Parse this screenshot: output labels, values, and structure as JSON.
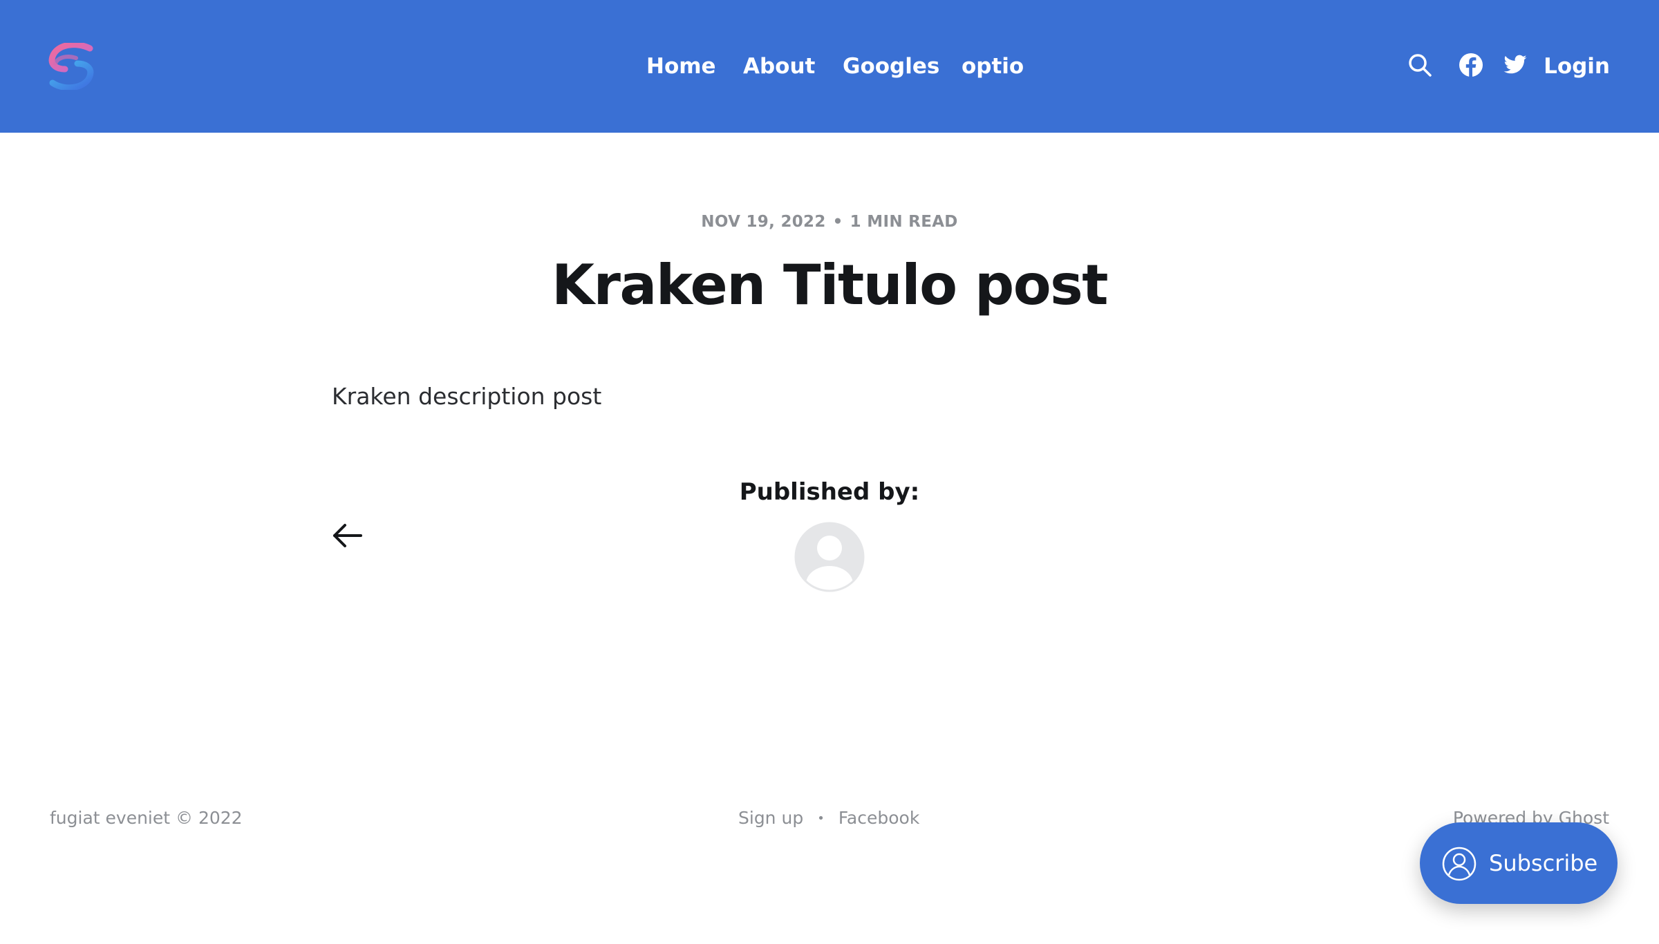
{
  "header": {
    "background_color": "#3a70d4",
    "logo_icon": "site-logo-icon",
    "nav": [
      {
        "label": "Home"
      },
      {
        "label": "About"
      },
      {
        "label": "Googles"
      },
      {
        "label": "optio"
      }
    ],
    "icons": [
      "search-icon",
      "facebook-icon",
      "twitter-icon"
    ],
    "login_label": "Login"
  },
  "post": {
    "date": "NOV 19, 2022",
    "separator": "•",
    "read_time": "1 MIN READ",
    "title": "Kraken Titulo post",
    "description": "Kraken description post",
    "published_by_label": "Published by:",
    "back_icon": "arrow-left-icon",
    "author_avatar_icon": "default-avatar-icon"
  },
  "footer": {
    "copyright": "fugiat eveniet © 2022",
    "links": [
      {
        "label": "Sign up"
      },
      {
        "label": "Facebook"
      }
    ],
    "link_separator": "•",
    "powered_by": "Powered by Ghost"
  },
  "subscribe": {
    "label": "Subscribe",
    "icon": "user-circle-icon",
    "color": "#3a70d4"
  }
}
